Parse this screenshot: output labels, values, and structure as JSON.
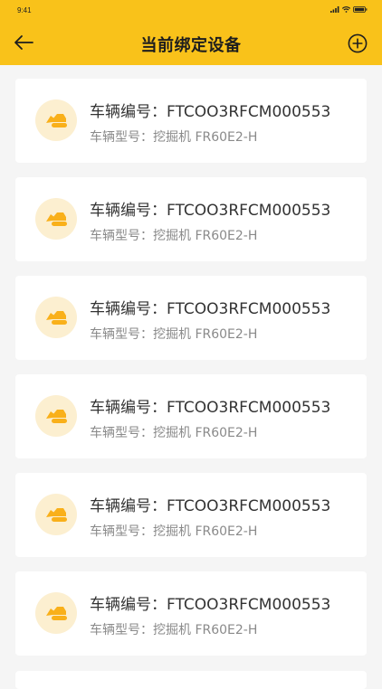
{
  "status_bar": {
    "time": "9:41"
  },
  "header": {
    "title": "当前绑定设备",
    "back_icon": "arrow-left-icon",
    "add_icon": "plus-circle-icon"
  },
  "colors": {
    "accent": "#F9C21A",
    "icon_bg": "#FCEFD0",
    "page_bg": "#F5F5F5"
  },
  "devices": [
    {
      "number_label": "车辆编号：",
      "number": "FTCOO3RFCM000553",
      "model_label": "车辆型号：",
      "model": "挖掘机 FR60E2-H",
      "icon": "excavator-icon"
    },
    {
      "number_label": "车辆编号：",
      "number": "FTCOO3RFCM000553",
      "model_label": "车辆型号：",
      "model": "挖掘机 FR60E2-H",
      "icon": "excavator-icon"
    },
    {
      "number_label": "车辆编号：",
      "number": "FTCOO3RFCM000553",
      "model_label": "车辆型号：",
      "model": "挖掘机 FR60E2-H",
      "icon": "excavator-icon"
    },
    {
      "number_label": "车辆编号：",
      "number": "FTCOO3RFCM000553",
      "model_label": "车辆型号：",
      "model": "挖掘机 FR60E2-H",
      "icon": "excavator-icon"
    },
    {
      "number_label": "车辆编号：",
      "number": "FTCOO3RFCM000553",
      "model_label": "车辆型号：",
      "model": "挖掘机 FR60E2-H",
      "icon": "excavator-icon"
    },
    {
      "number_label": "车辆编号：",
      "number": "FTCOO3RFCM000553",
      "model_label": "车辆型号：",
      "model": "挖掘机 FR60E2-H",
      "icon": "excavator-icon"
    }
  ]
}
